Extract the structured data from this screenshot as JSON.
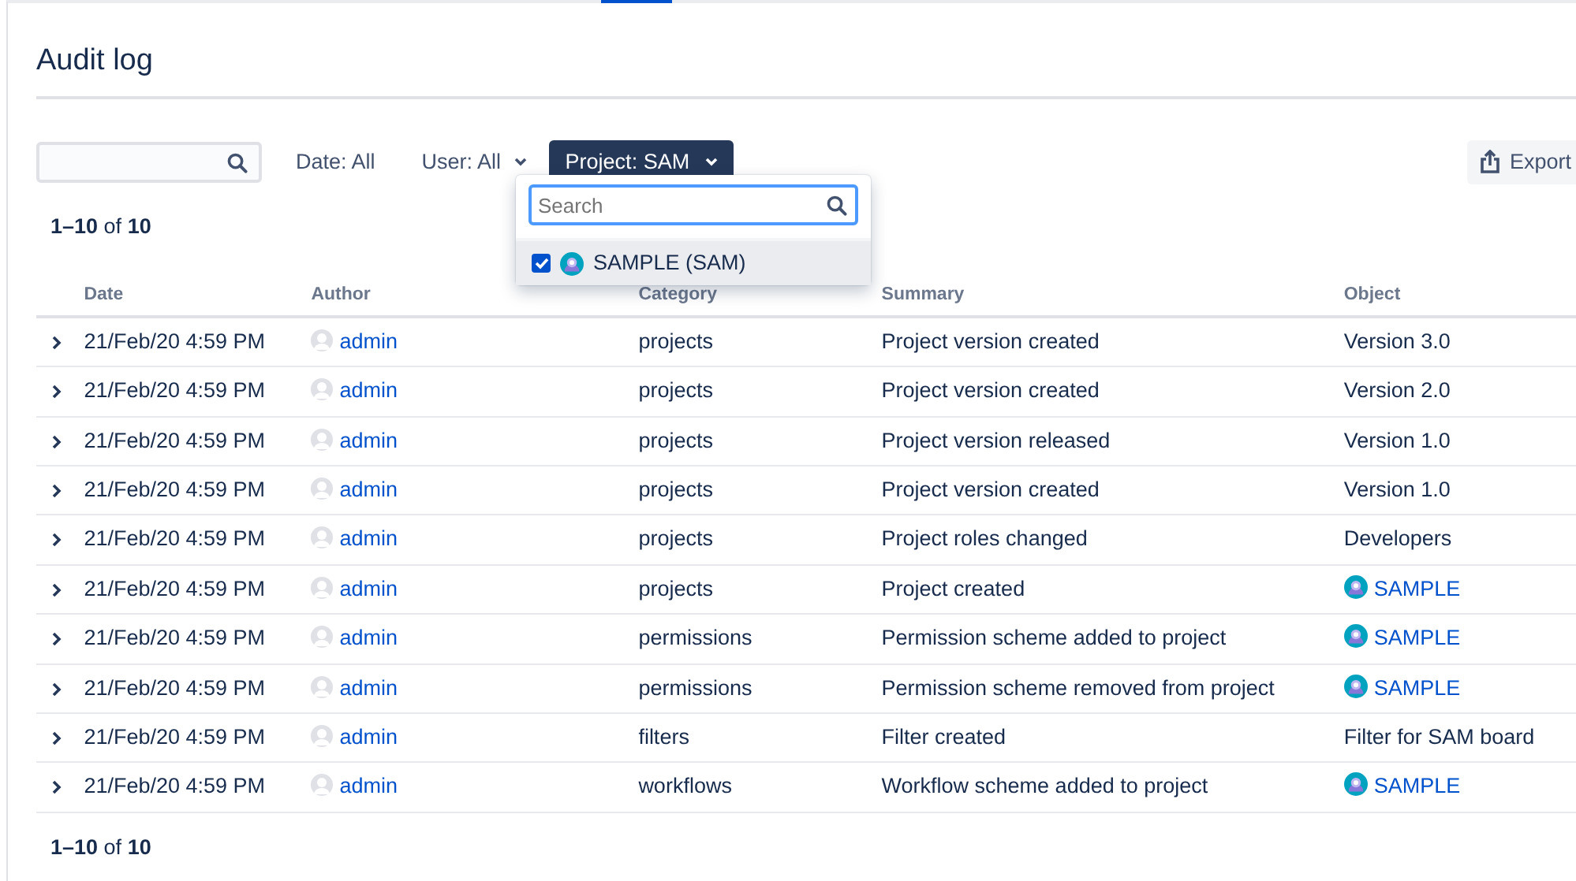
{
  "page": {
    "title": "Audit log"
  },
  "toolbar": {
    "date_filter": "Date: All",
    "user_filter": "User: All",
    "project_filter": {
      "label": "Project: SAM",
      "open": true
    },
    "export_button": "Export"
  },
  "project_dropdown": {
    "search": {
      "placeholder": "Search"
    },
    "options": [
      {
        "label": "SAMPLE (SAM)",
        "checked": true
      }
    ]
  },
  "count_top": {
    "range": "1–10",
    "of": "of",
    "total": "10"
  },
  "table": {
    "columns": [
      "Date",
      "Author",
      "Category",
      "Summary",
      "Object"
    ],
    "rows": [
      {
        "date": "21/Feb/20 4:59 PM",
        "author": "admin",
        "category": "projects",
        "summary": "Project version created",
        "object": {
          "kind": "text",
          "label": "Version 3.0"
        }
      },
      {
        "date": "21/Feb/20 4:59 PM",
        "author": "admin",
        "category": "projects",
        "summary": "Project version created",
        "object": {
          "kind": "text",
          "label": "Version 2.0"
        }
      },
      {
        "date": "21/Feb/20 4:59 PM",
        "author": "admin",
        "category": "projects",
        "summary": "Project version released",
        "object": {
          "kind": "text",
          "label": "Version 1.0"
        }
      },
      {
        "date": "21/Feb/20 4:59 PM",
        "author": "admin",
        "category": "projects",
        "summary": "Project version created",
        "object": {
          "kind": "text",
          "label": "Version 1.0"
        }
      },
      {
        "date": "21/Feb/20 4:59 PM",
        "author": "admin",
        "category": "projects",
        "summary": "Project roles changed",
        "object": {
          "kind": "text",
          "label": "Developers"
        }
      },
      {
        "date": "21/Feb/20 4:59 PM",
        "author": "admin",
        "category": "projects",
        "summary": "Project created",
        "object": {
          "kind": "project",
          "label": "SAMPLE"
        }
      },
      {
        "date": "21/Feb/20 4:59 PM",
        "author": "admin",
        "category": "permissions",
        "summary": "Permission scheme added to project",
        "object": {
          "kind": "project",
          "label": "SAMPLE"
        }
      },
      {
        "date": "21/Feb/20 4:59 PM",
        "author": "admin",
        "category": "permissions",
        "summary": "Permission scheme removed from project",
        "object": {
          "kind": "project",
          "label": "SAMPLE"
        }
      },
      {
        "date": "21/Feb/20 4:59 PM",
        "author": "admin",
        "category": "filters",
        "summary": "Filter created",
        "object": {
          "kind": "text",
          "label": "Filter for SAM board"
        }
      },
      {
        "date": "21/Feb/20 4:59 PM",
        "author": "admin",
        "category": "workflows",
        "summary": "Workflow scheme added to project",
        "object": {
          "kind": "project",
          "label": "SAMPLE"
        }
      }
    ]
  },
  "count_bottom": {
    "range": "1–10",
    "of": "of",
    "total": "10"
  }
}
